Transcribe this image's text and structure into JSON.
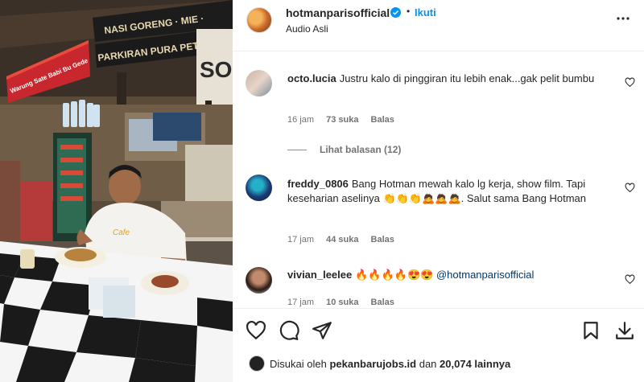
{
  "video": {
    "signs": {
      "banner_top": "NASI GORENG · MIE ·",
      "parking": "PARKIRAN PURA PETITENGET",
      "warung": "Warung Sate Babi Bu Gede",
      "side": "SO"
    },
    "shirt_text": "Cafe"
  },
  "header": {
    "username": "hotmanparisofficial",
    "dot": "•",
    "follow_label": "Ikuti",
    "subtitle": "Audio Asli",
    "more_icon": "more-horizontal-icon"
  },
  "comments": [
    {
      "username": "octo.lucia",
      "text": "Justru kalo di pinggiran itu lebih enak...gak pelit bumbu",
      "time": "16 jam",
      "likes": "73 suka",
      "reply": "Balas"
    },
    {
      "username": "freddy_0806",
      "text": "Bang Hotman mewah kalo lg kerja, show film. Tapi keseharian aselinya 👏👏👏🙇🙇🙇. Salut sama Bang Hotman",
      "time": "17 jam",
      "likes": "44 suka",
      "reply": "Balas"
    },
    {
      "username": "vivian_leelee",
      "emojis": "🔥🔥🔥🔥😍😍",
      "mention": "@hotmanparisofficial",
      "time": "17 jam",
      "likes": "10 suka",
      "reply": "Balas"
    }
  ],
  "view_replies": "Lihat balasan (12)",
  "footer": {
    "liked_by_prefix": "Disukai oleh",
    "liked_by_user": "pekanbarujobs.id",
    "liked_by_and": "dan",
    "liked_by_count": "20,074 lainnya"
  },
  "colors": {
    "accent": "#0095f6",
    "text": "#262626",
    "muted": "#737373",
    "mention": "#00376b"
  }
}
